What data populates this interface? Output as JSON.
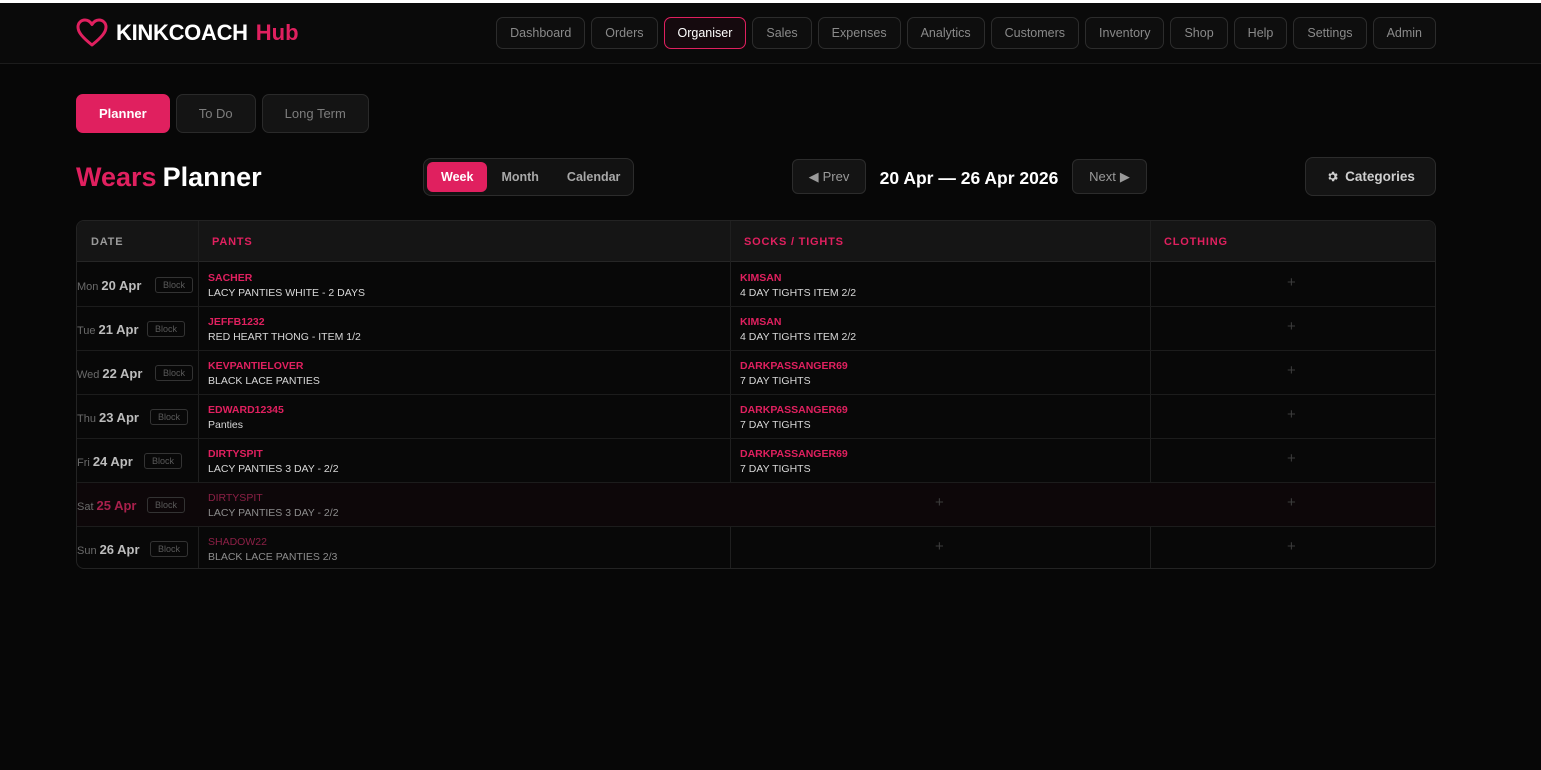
{
  "header": {
    "brand": "KINKCOACH",
    "hub": "Hub",
    "nav": [
      {
        "label": "Dashboard",
        "active": false
      },
      {
        "label": "Orders",
        "active": false
      },
      {
        "label": "Organiser",
        "active": true
      },
      {
        "label": "Sales",
        "active": false
      },
      {
        "label": "Expenses",
        "active": false
      },
      {
        "label": "Analytics",
        "active": false
      },
      {
        "label": "Customers",
        "active": false
      },
      {
        "label": "Inventory",
        "active": false
      },
      {
        "label": "Shop",
        "active": false
      },
      {
        "label": "Help",
        "active": false
      },
      {
        "label": "Settings",
        "active": false
      },
      {
        "label": "Admin",
        "active": false
      }
    ]
  },
  "subtabs": [
    "Planner",
    "To Do",
    "Long Term"
  ],
  "page": {
    "title_accent": "Wears",
    "title_rest": "Planner",
    "views": [
      "Week",
      "Month",
      "Calendar"
    ],
    "prev_label": "Prev",
    "next_label": "Next",
    "range": "20 Apr — 26 Apr 2026",
    "categories_label": "Categories"
  },
  "table": {
    "headers": {
      "date": "DATE",
      "pants": "PANTS",
      "socks": "SOCKS / TIGHTS",
      "clothing": "CLOTHING"
    },
    "block_label": "Block",
    "plus": "+",
    "rows": [
      {
        "dow": "Mon",
        "date": "20 Apr",
        "pants": {
          "customer": "SACHER",
          "item": "LACY PANTIES WHITE - 2 DAYS"
        },
        "socks": {
          "customer": "KIMSAN",
          "item": "4 DAY TIGHTS ITEM 2/2"
        }
      },
      {
        "dow": "Tue",
        "date": "21 Apr",
        "pants": {
          "customer": "JEFFB1232",
          "item": "RED HEART THONG - ITEM 1/2"
        },
        "socks": {
          "customer": "KIMSAN",
          "item": "4 DAY TIGHTS ITEM 2/2"
        }
      },
      {
        "dow": "Wed",
        "date": "22 Apr",
        "pants": {
          "customer": "KEVPANTIELOVER",
          "item": "BLACK LACE PANTIES"
        },
        "socks": {
          "customer": "DARKPASSANGER69",
          "item": "7 DAY TIGHTS"
        }
      },
      {
        "dow": "Thu",
        "date": "23 Apr",
        "pants": {
          "customer": "EDWARD12345",
          "item": "Panties"
        },
        "socks": {
          "customer": "DARKPASSANGER69",
          "item": "7 DAY TIGHTS"
        }
      },
      {
        "dow": "Fri",
        "date": "24 Apr",
        "pants": {
          "customer": "DIRTYSPIT",
          "item": "LACY PANTIES 3 DAY - 2/2"
        },
        "socks": {
          "customer": "DARKPASSANGER69",
          "item": "7 DAY TIGHTS"
        }
      },
      {
        "dow": "Sat",
        "date": "25 Apr",
        "pants": {
          "customer": "DIRTYSPIT",
          "item": "LACY PANTIES 3 DAY - 2/2"
        },
        "socks": null
      },
      {
        "dow": "Sun",
        "date": "26 Apr",
        "pants": {
          "customer": "SHADOW22",
          "item": "BLACK LACE PANTIES 2/3"
        },
        "socks": null
      }
    ]
  },
  "colors": {
    "accent": "#e0205f",
    "background": "#070707"
  }
}
